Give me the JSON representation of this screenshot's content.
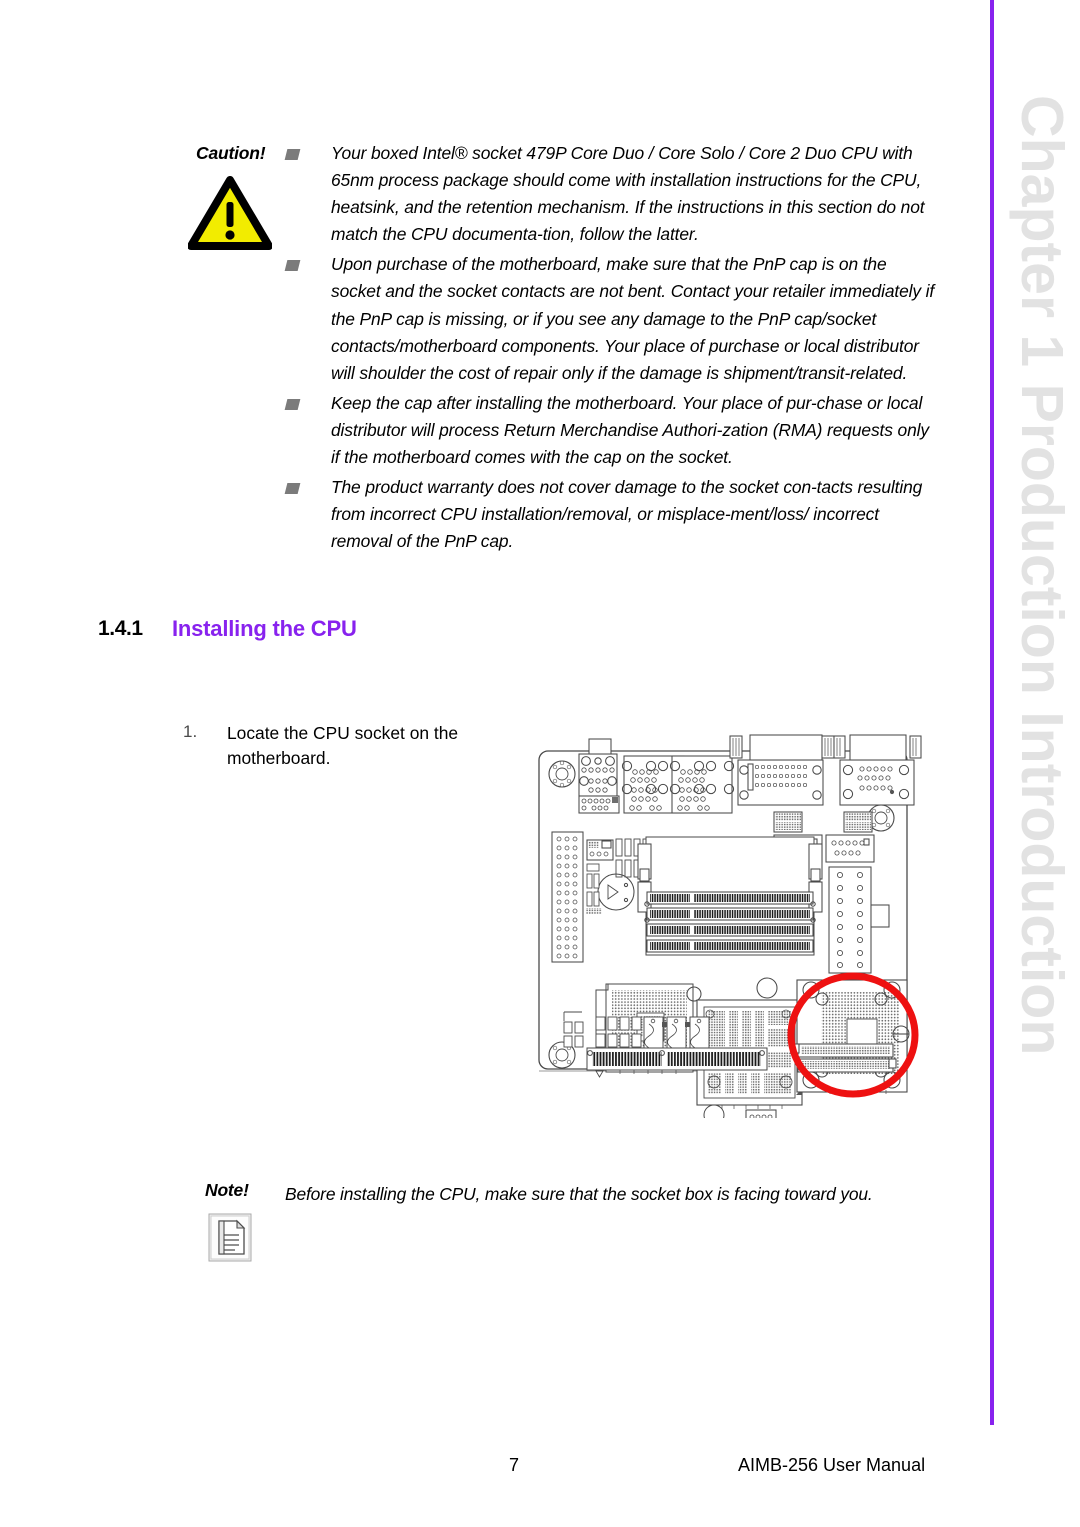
{
  "page": {
    "background": "#ffffff",
    "accent_color": "#8822ee",
    "rail_text_color": "#e2e2e2"
  },
  "chapter_rail": {
    "text": "Chapter 1  Production Introduction"
  },
  "caution": {
    "label": "Caution!",
    "icon": "warning-triangle-icon",
    "items": [
      "Your boxed Intel® socket 479P Core Duo / Core Solo / Core 2 Duo CPU with 65nm process package should come with installation instructions for the CPU, heatsink, and the retention mechanism. If the instructions in this section do not match the CPU documenta-tion, follow the latter.",
      "Upon purchase of the motherboard, make sure that the PnP cap is on the socket and the socket contacts are not bent. Contact your retailer immediately if the PnP cap is missing, or if you see any damage to the PnP cap/socket contacts/motherboard components. Your place of purchase or local distributor will shoulder the cost of repair only if the damage is shipment/transit-related.",
      "Keep the cap after installing the motherboard. Your place of pur-chase or local distributor will process Return Merchandise Authori-zation (RMA) requests only if the motherboard comes with the cap on the socket.",
      "The product warranty does not cover damage to the socket con-tacts resulting from incorrect CPU installation/removal, or misplace-ment/loss/ incorrect removal of the PnP cap."
    ]
  },
  "section": {
    "number": "1.4.1",
    "title": "Installing the CPU"
  },
  "steps": [
    {
      "number": "1.",
      "text": "Locate the CPU socket on the motherboard."
    }
  ],
  "figure": {
    "name": "motherboard-diagram",
    "highlight": {
      "shape": "circle",
      "color": "#ee1111",
      "target": "cpu-socket"
    }
  },
  "note": {
    "label": "Note!",
    "icon": "document-note-icon",
    "text": "Before installing the CPU, make sure that the socket box is facing toward you."
  },
  "footer": {
    "page_number": "7",
    "manual_title": "AIMB-256 User Manual"
  }
}
